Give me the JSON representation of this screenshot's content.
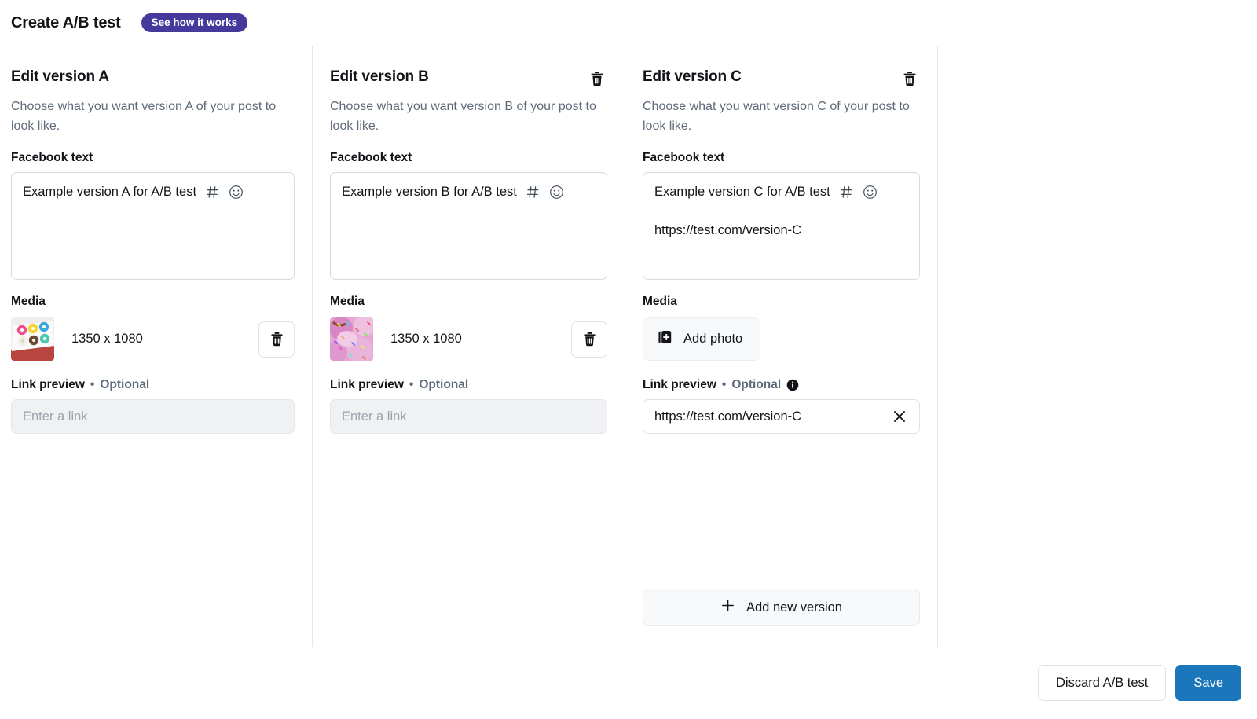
{
  "header": {
    "title": "Create A/B test",
    "badge_label": "See how it works"
  },
  "columns": [
    {
      "title": "Edit version A",
      "description": "Choose what you want version A of your post to look like.",
      "has_header_delete": false,
      "text_field": {
        "label": "Facebook text",
        "value": "Example version A for A/B test",
        "extra_line": "",
        "hashtag_icon": "hashtag-icon",
        "emoji_icon": "emoji-icon"
      },
      "media": {
        "label": "Media",
        "has_image": true,
        "size": "1350 x 1080",
        "thumb": "donuts-box-thumbnail",
        "delete_icon": "trash-icon",
        "add_photo_label": "Add photo"
      },
      "link_preview": {
        "label": "Link preview",
        "separator": "•",
        "optional": "Optional",
        "has_info_icon": false,
        "placeholder": "Enter a link",
        "value": "",
        "disabled": true
      }
    },
    {
      "title": "Edit version B",
      "description": "Choose what you want version B of your post to look like.",
      "has_header_delete": true,
      "text_field": {
        "label": "Facebook text",
        "value": "Example version B for A/B test",
        "extra_line": "",
        "hashtag_icon": "hashtag-icon",
        "emoji_icon": "emoji-icon"
      },
      "media": {
        "label": "Media",
        "has_image": true,
        "size": "1350 x 1080",
        "thumb": "sprinkle-donuts-thumbnail",
        "delete_icon": "trash-icon",
        "add_photo_label": "Add photo"
      },
      "link_preview": {
        "label": "Link preview",
        "separator": "•",
        "optional": "Optional",
        "has_info_icon": false,
        "placeholder": "Enter a link",
        "value": "",
        "disabled": true
      }
    },
    {
      "title": "Edit version C",
      "description": "Choose what you want version C of your post to look like.",
      "has_header_delete": true,
      "text_field": {
        "label": "Facebook text",
        "value": "Example version C for A/B test",
        "extra_line": "https://test.com/version-C",
        "hashtag_icon": "hashtag-icon",
        "emoji_icon": "emoji-icon"
      },
      "media": {
        "label": "Media",
        "has_image": false,
        "size": "",
        "thumb": "",
        "delete_icon": "trash-icon",
        "add_photo_label": "Add photo"
      },
      "link_preview": {
        "label": "Link preview",
        "separator": "•",
        "optional": "Optional",
        "has_info_icon": true,
        "placeholder": "Enter a link",
        "value": "https://test.com/version-C",
        "disabled": false
      },
      "add_version_label": "Add new version"
    }
  ],
  "footer": {
    "discard_label": "Discard A/B test",
    "save_label": "Save"
  },
  "colors": {
    "badge_purple": "#453a9c",
    "primary_blue": "#1b76bc",
    "text_dark": "#121418",
    "text_muted": "#5f6b7a",
    "border": "#e4e6e8",
    "disabled_fill": "#f0f1f3"
  }
}
